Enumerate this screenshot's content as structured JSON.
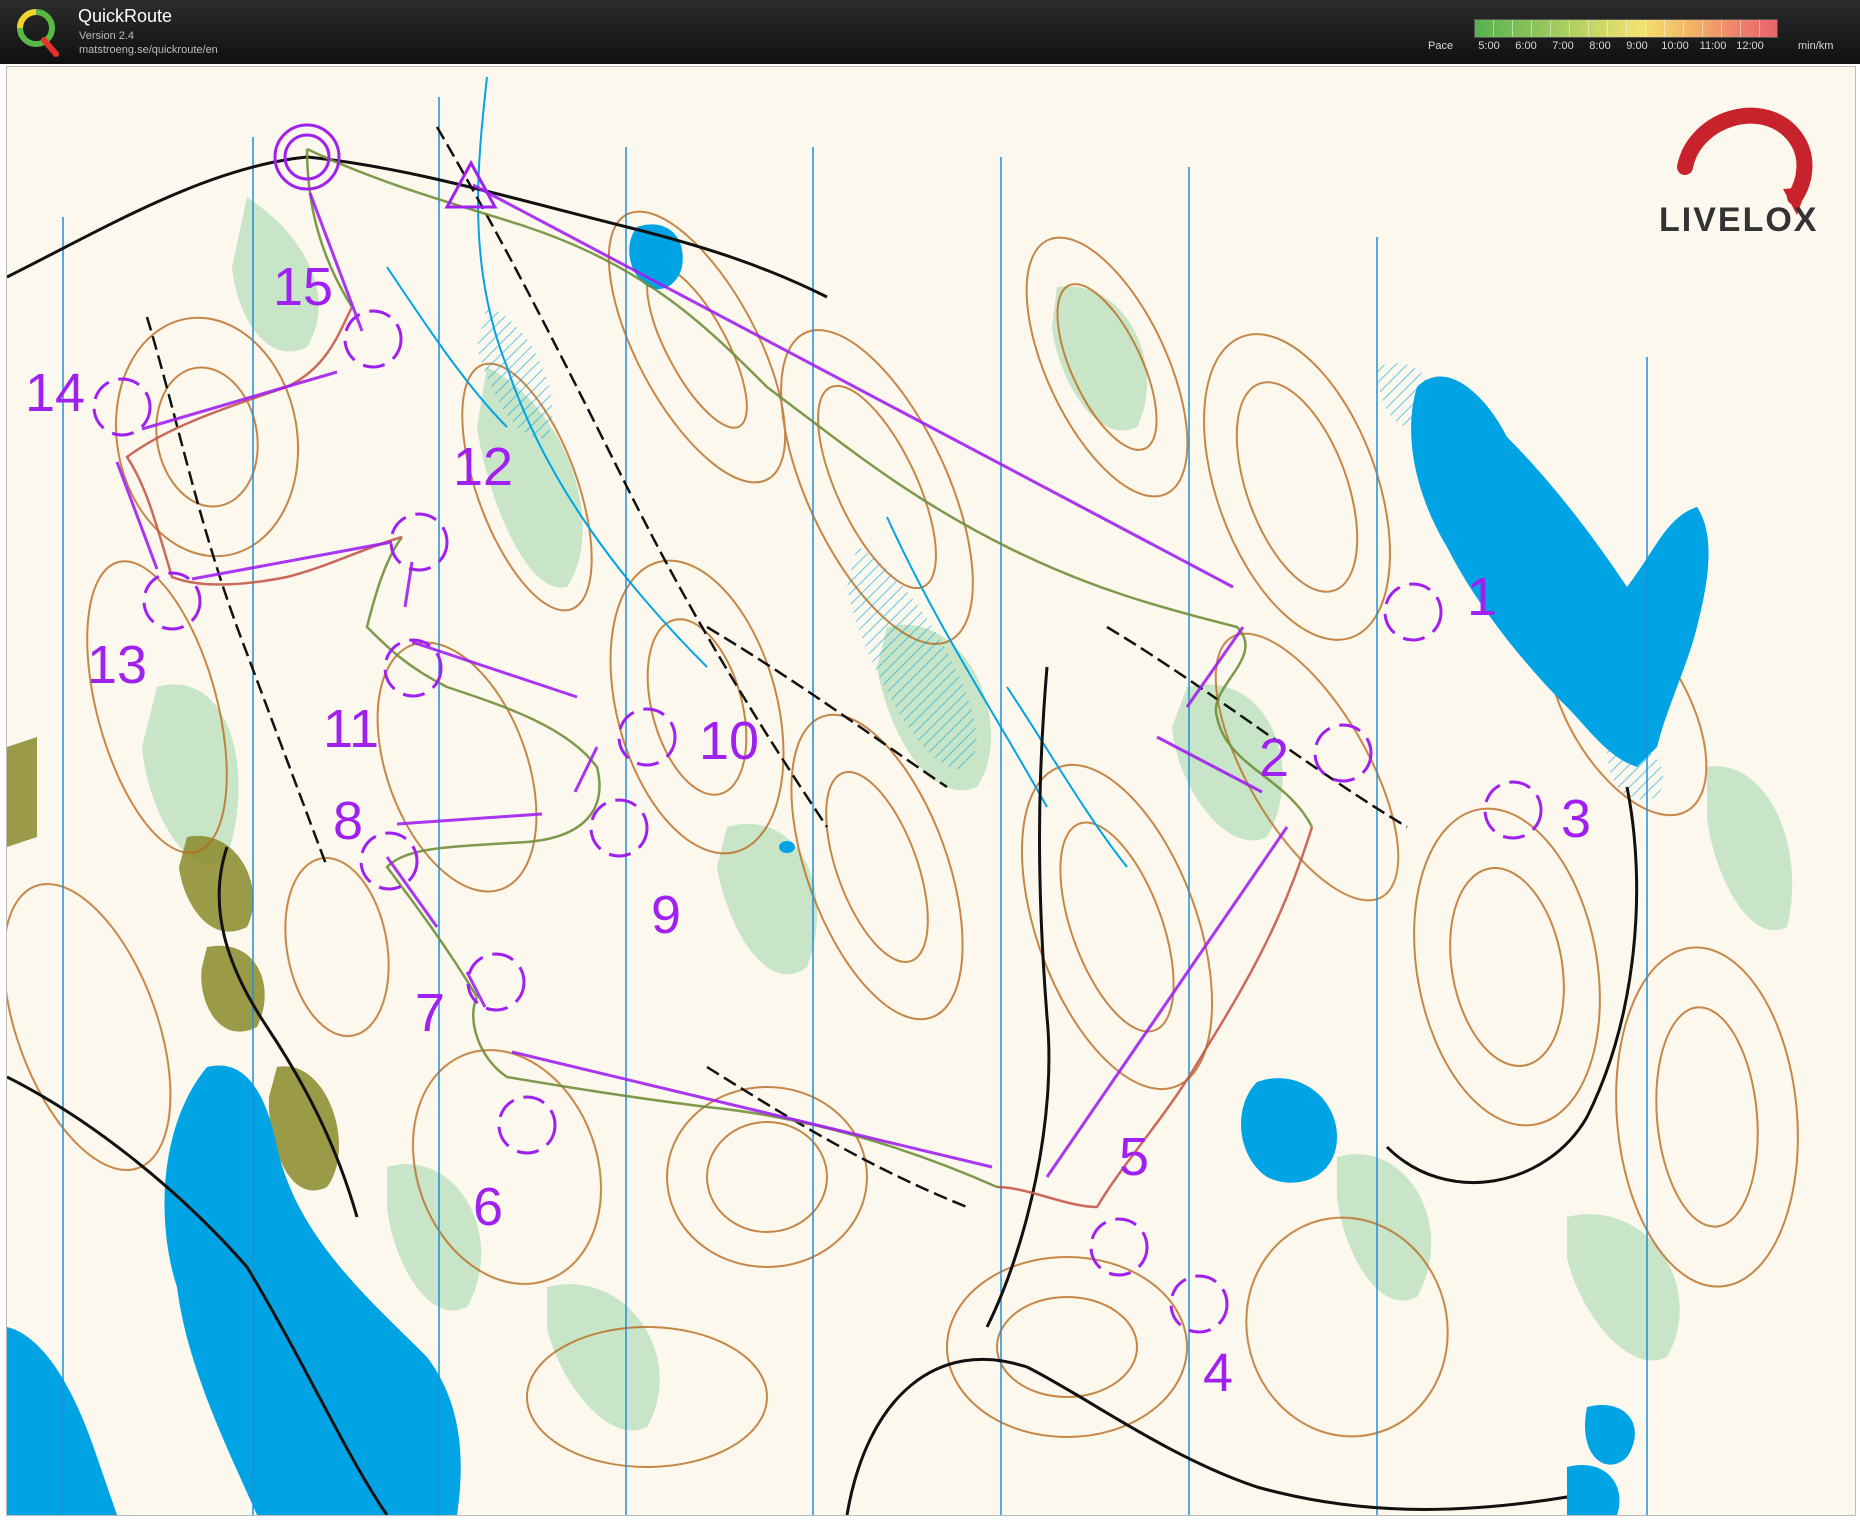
{
  "app": {
    "title": "QuickRoute",
    "version": "Version 2.4",
    "url": "matstroeng.se/quickroute/en"
  },
  "pace_legend": {
    "label": "Pace",
    "ticks": [
      "5:00",
      "6:00",
      "7:00",
      "8:00",
      "9:00",
      "10:00",
      "11:00",
      "12:00"
    ],
    "unit": "min/km"
  },
  "brand": {
    "livelox_text": "LIVELOX"
  },
  "map": {
    "course_color": "#a020f0",
    "water_color": "#00a4e4",
    "contour_color": "#b86a1e",
    "control_labels": [
      "1",
      "2",
      "3",
      "4",
      "5",
      "6",
      "7",
      "8",
      "9",
      "10",
      "11",
      "12",
      "13",
      "14",
      "15"
    ]
  }
}
